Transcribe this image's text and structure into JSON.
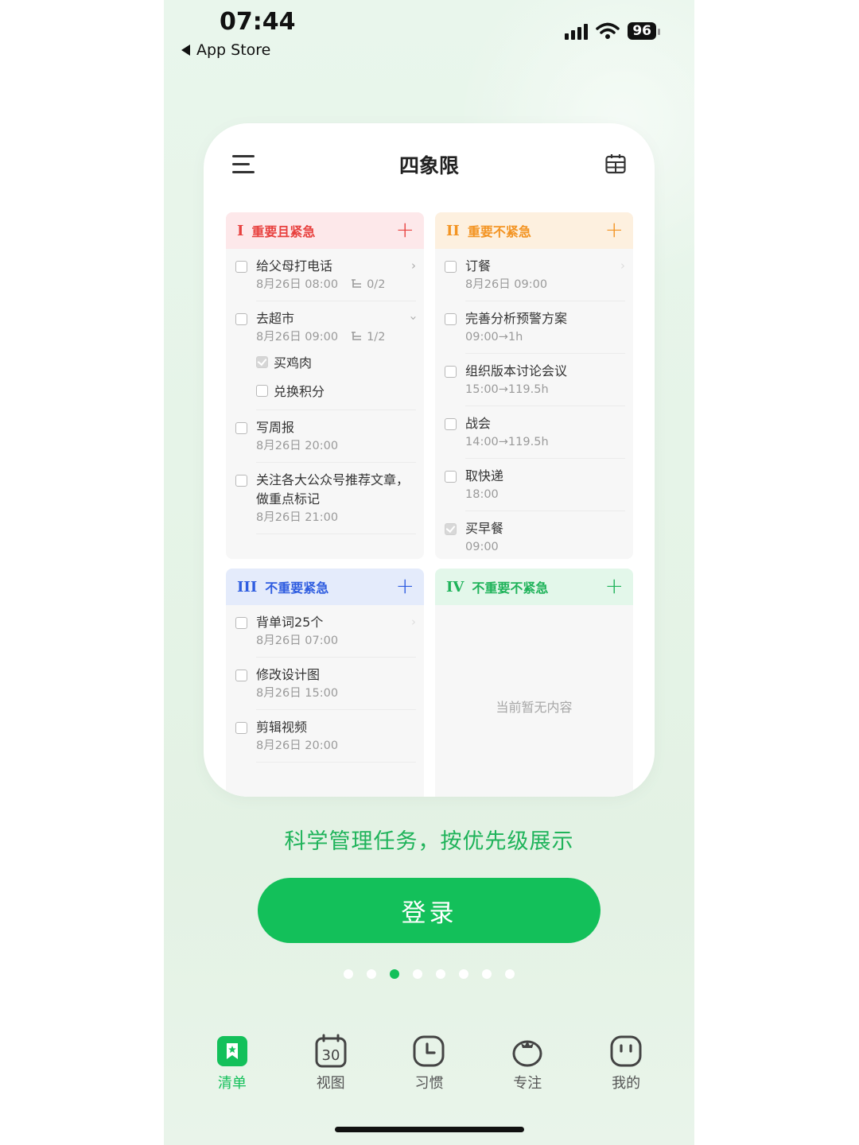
{
  "status_bar": {
    "time": "07:44",
    "back_label": "App Store",
    "battery": "96"
  },
  "header": {
    "title": "四象限",
    "left_icon": "menu-icon",
    "right_icon": "calendar-icon"
  },
  "quadrants": [
    {
      "num": "I",
      "name": "重要且紧急",
      "color": "#e8413f",
      "tasks": [
        {
          "title": "给父母打电话",
          "date": "8月26日 08:00",
          "subtasks": "0/2"
        },
        {
          "title": "去超市",
          "date": "8月26日 09:00",
          "subtasks": "1/2",
          "items": [
            {
              "title": "买鸡肉",
              "done": true
            },
            {
              "title": "兑换积分",
              "done": false
            }
          ]
        },
        {
          "title": "写周报",
          "date": "8月26日 20:00"
        },
        {
          "title": "关注各大公众号推荐文章，",
          "title2": "做重点标记",
          "date": "8月26日 21:00"
        }
      ]
    },
    {
      "num": "II",
      "name": "重要不紧急",
      "color": "#f39423",
      "tasks": [
        {
          "title": "订餐",
          "date": "8月26日 09:00"
        },
        {
          "title": "完善分析预警方案",
          "date": "09:00→1h"
        },
        {
          "title": "组织版本讨论会议",
          "date": "15:00→119.5h"
        },
        {
          "title": "战会",
          "date": "14:00→119.5h"
        },
        {
          "title": "取快递",
          "date": "18:00"
        },
        {
          "title": "买早餐",
          "date": "09:00",
          "done": true
        }
      ]
    },
    {
      "num": "III",
      "name": "不重要紧急",
      "color": "#2f5de0",
      "tasks": [
        {
          "title": "背单词25个",
          "date": "8月26日 07:00"
        },
        {
          "title": "修改设计图",
          "date": "8月26日 15:00"
        },
        {
          "title": "剪辑视频",
          "date": "8月26日 20:00"
        }
      ]
    },
    {
      "num": "IV",
      "name": "不重要不紧急",
      "color": "#1fb35a",
      "empty": "当前暂无内容"
    }
  ],
  "slogan": "科学管理任务，按优先级展示",
  "login_label": "登录",
  "pager": {
    "count": 8,
    "active": 3
  },
  "tabbar": [
    {
      "label": "清单",
      "icon": "list-icon",
      "active": true
    },
    {
      "label": "视图",
      "icon": "calendar-view-icon",
      "badge": "30"
    },
    {
      "label": "习惯",
      "icon": "clock-icon"
    },
    {
      "label": "专注",
      "icon": "tomato-icon"
    },
    {
      "label": "我的",
      "icon": "profile-icon"
    }
  ],
  "colors": {
    "accent": "#13c05a"
  }
}
